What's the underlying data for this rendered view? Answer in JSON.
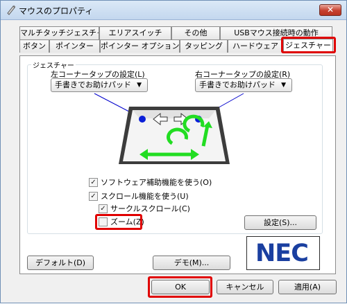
{
  "window": {
    "title": "マウスのプロパティ",
    "close_label": "✕"
  },
  "tabs_row1": [
    {
      "label": "マルチタッチジェスチャー"
    },
    {
      "label": "エリアスイッチ"
    },
    {
      "label": "その他"
    },
    {
      "label": "USBマウス接続時の動作"
    }
  ],
  "tabs_row2": [
    {
      "label": "ボタン"
    },
    {
      "label": "ポインター"
    },
    {
      "label": "ポインター オプション"
    },
    {
      "label": "タッピング"
    },
    {
      "label": "ハードウェア"
    },
    {
      "label": "ジェスチャー"
    }
  ],
  "gesture_group": {
    "legend": "ジェスチャー",
    "left_corner_label": "左コーナータップの設定(L)",
    "left_corner_value": "手書きでお助けパッド",
    "right_corner_label": "右コーナータップの設定(R)",
    "right_corner_value": "手書きでお助けパッド",
    "checkboxes": [
      {
        "label": "ソフトウェア補助機能を使う(O)",
        "checked": true
      },
      {
        "label": "スクロール機能を使う(U)",
        "checked": true
      },
      {
        "label": "サークルスクロール(C)",
        "checked": true
      },
      {
        "label": "ズーム(Z)",
        "checked": false
      }
    ],
    "settings_button": "設定(S)..."
  },
  "default_button": "デフォルト(D)",
  "demo_button": "デモ(M)...",
  "brand": {
    "logo_text": "NEC",
    "color": "#1a3fa0"
  },
  "footer": {
    "ok": "OK",
    "cancel": "キャンセル",
    "apply": "適用(A)"
  },
  "colors": {
    "highlight": "#e00000",
    "gesture_green": "#22dd22",
    "corner_dot": "#0a1fd8"
  }
}
